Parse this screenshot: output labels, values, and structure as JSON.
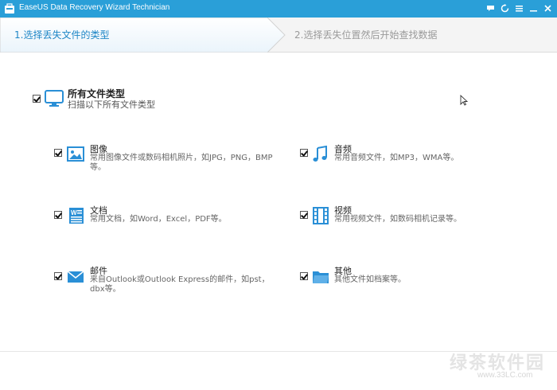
{
  "window": {
    "title": "EaseUS Data Recovery Wizard Technician",
    "controls": [
      "chat-icon",
      "refresh-icon",
      "menu-icon",
      "minimize-icon",
      "close-icon"
    ]
  },
  "wizard": {
    "step1": "1.选择丢失文件的类型",
    "step2": "2.选择丢失位置然后开始查找数据"
  },
  "all_types": {
    "checked": true,
    "title": "所有文件类型",
    "desc": "扫描以下所有文件类型"
  },
  "types": [
    {
      "key": "image",
      "checked": true,
      "title": "图像",
      "desc": "常用图像文件或数码相机照片，如JPG，PNG，BMP等。"
    },
    {
      "key": "audio",
      "checked": true,
      "title": "音频",
      "desc": "常用音频文件，如MP3，WMA等。"
    },
    {
      "key": "document",
      "checked": true,
      "title": "文档",
      "desc": "常用文档，如Word，Excel，PDF等。"
    },
    {
      "key": "video",
      "checked": true,
      "title": "视频",
      "desc": "常用视频文件，如数码相机记录等。"
    },
    {
      "key": "email",
      "checked": true,
      "title": "邮件",
      "desc": "来自Outlook或Outlook Express的邮件，如pst，dbx等。"
    },
    {
      "key": "other",
      "checked": true,
      "title": "其他",
      "desc": "其他文件如档案等。"
    }
  ],
  "watermark": {
    "text": "绿茶软件园",
    "url": "www.33LC.com"
  },
  "colors": {
    "titlebar": "#2a9fd8",
    "accent": "#1e86c6",
    "icon_blue": "#2a8fd6"
  }
}
